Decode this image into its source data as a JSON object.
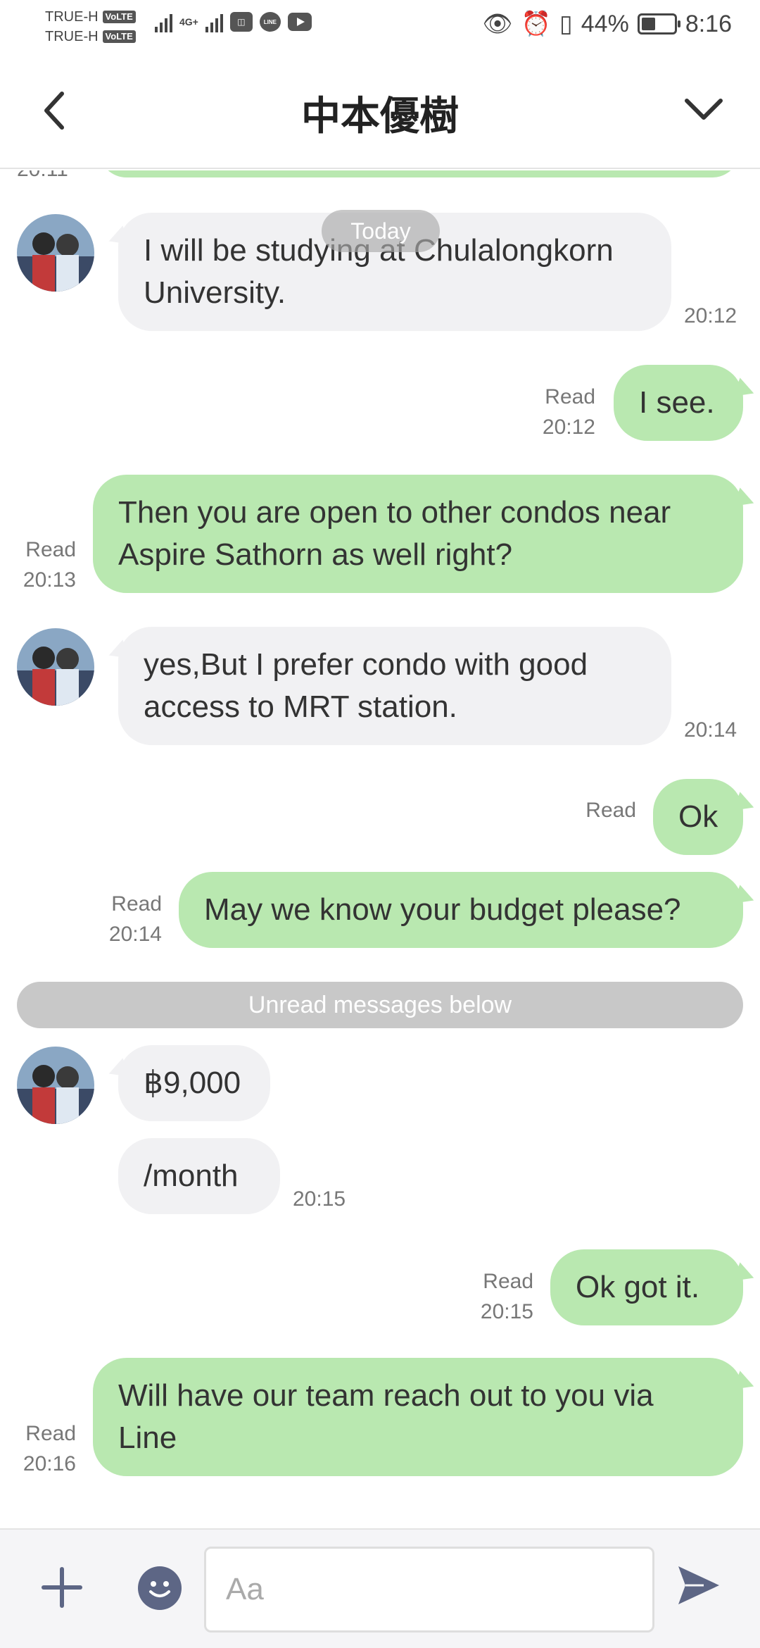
{
  "status_bar": {
    "carrier1": "TRUE-H",
    "carrier2": "TRUE-H",
    "volte": "VoLTE",
    "network": "4G+",
    "battery_percent": "44%",
    "battery_level": 0.44,
    "time": "8:16"
  },
  "header": {
    "title": "中本優樹"
  },
  "chat": {
    "prev_time": "20:11",
    "today_label": "Today",
    "unread_label": "Unread messages below",
    "messages": [
      {
        "side": "in",
        "text": "I will be studying at Chulalongkorn University.",
        "time": "20:12"
      },
      {
        "side": "out",
        "text": "I see.",
        "read": "Read",
        "time": "20:12"
      },
      {
        "side": "out",
        "text": "Then you are open to other condos near Aspire Sathorn as well right?",
        "read": "Read",
        "time": "20:13"
      },
      {
        "side": "in",
        "text": "yes,But I prefer condo with good access to MRT station.",
        "time": "20:14"
      },
      {
        "side": "out",
        "text": "Ok",
        "read": "Read",
        "time": ""
      },
      {
        "side": "out",
        "text": "May we know your budget please?",
        "read": "Read",
        "time": "20:14"
      },
      {
        "side": "in",
        "text": "฿9,000",
        "time": ""
      },
      {
        "side": "in",
        "text": "/month",
        "time": "20:15"
      },
      {
        "side": "out",
        "text": "Ok got it.",
        "read": "Read",
        "time": "20:15"
      },
      {
        "side": "out",
        "text": "Will have our team reach out to you via Line",
        "read": "Read",
        "time": "20:16"
      }
    ]
  },
  "input": {
    "placeholder": "Aa"
  },
  "colors": {
    "outgoing_bubble": "#b9e8b0",
    "incoming_bubble": "#f1f1f3",
    "icon": "#5d6685"
  }
}
